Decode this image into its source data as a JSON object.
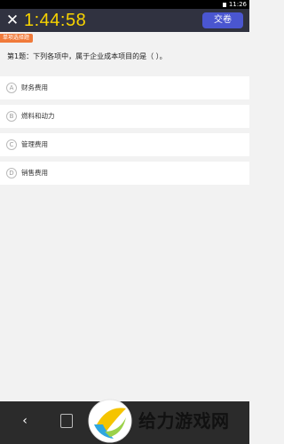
{
  "status_bar": {
    "time": "11:26"
  },
  "header": {
    "timer": "1:44:58",
    "submit_label": "交卷",
    "close_icon": "close-icon"
  },
  "question": {
    "type_tag": "单项选择题",
    "text": "第1题：下列各项中，属于企业成本项目的是（      ）。",
    "options": [
      {
        "letter": "A",
        "text": "财务费用"
      },
      {
        "letter": "B",
        "text": "燃料和动力"
      },
      {
        "letter": "C",
        "text": "管理费用"
      },
      {
        "letter": "D",
        "text": "销售费用"
      }
    ]
  },
  "watermark": {
    "text": "给力游戏网"
  },
  "colors": {
    "header_bg": "#303240",
    "timer": "#f7d300",
    "submit_bg": "#4a56d0",
    "tag_bg": "#f07a3a"
  }
}
